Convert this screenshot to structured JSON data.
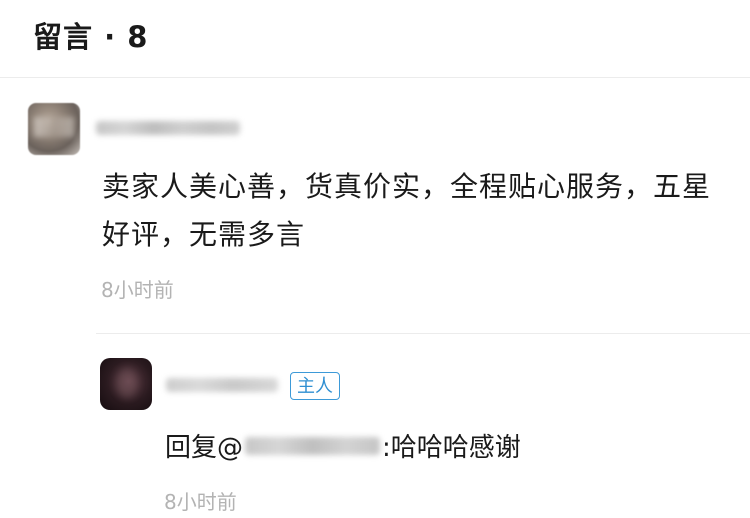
{
  "header": {
    "title": "留言 · 8"
  },
  "comment": {
    "text": "卖家人美心善，货真价实，全程贴心服务，五星好评，无需多言",
    "time": "8小时前"
  },
  "reply": {
    "badge": "主人",
    "prefix": "回复@",
    "message": ":哈哈哈感谢",
    "time": "8小时前"
  }
}
